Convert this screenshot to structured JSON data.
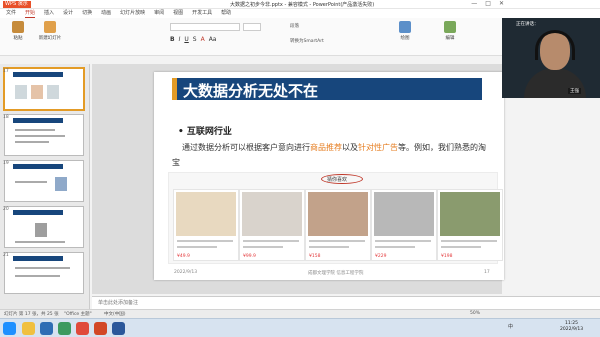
{
  "window": {
    "app_label": "WPS 演示",
    "title": "大数据之初步今非.pptx - 兼容模式 - PowerPoint(产品激活失败)",
    "controls": [
      "—",
      "□",
      "✕"
    ]
  },
  "ribbon": {
    "tabs": [
      "文件",
      "开始",
      "插入",
      "设计",
      "切换",
      "动画",
      "幻灯片放映",
      "审阅",
      "视图",
      "开发工具",
      "帮助"
    ],
    "active_tab": "开始",
    "groups": {
      "paste": "粘贴",
      "new_slide": "新建幻灯片",
      "font_name": "",
      "font_size": "",
      "format_row": [
        "B",
        "I",
        "U",
        "S",
        "A",
        "Aa"
      ],
      "paragraph": "段落",
      "drawing": "绘图",
      "edit": "编辑",
      "convert": "转换为SmartArt"
    }
  },
  "slide_panel": {
    "slides": [
      {
        "num": "17",
        "active": true
      },
      {
        "num": "18",
        "active": false
      },
      {
        "num": "19",
        "active": false
      },
      {
        "num": "20",
        "active": false
      },
      {
        "num": "21",
        "active": false
      },
      {
        "num": "22",
        "active": false
      }
    ]
  },
  "slide": {
    "title": "大数据分析无处不在",
    "bullet": "•   互联网行业",
    "para_pre": "通过数据分析可以根据客户意向进行",
    "hl1": "商品推荐",
    "para_mid": "以及",
    "hl2": "针对性广告",
    "para_post": "等。例如，我们熟悉的淘宝",
    "screenshot_label": "猜你喜欢",
    "products": [
      {
        "price": "¥49.9"
      },
      {
        "price": "¥99.9"
      },
      {
        "price": "¥158"
      },
      {
        "price": "¥229"
      },
      {
        "price": "¥198"
      }
    ],
    "footer_date": "2022/9/13",
    "footer_school": "成都文理学院 信息工程学院",
    "page": "17",
    "accent": "#e39b26",
    "title_bg": "#17467c"
  },
  "notes": {
    "placeholder": "单击此处添加备注"
  },
  "status": {
    "slide_info": "幻灯片 第 17 张，共 25 张",
    "theme": "\"Office 主题\"",
    "lang": "中文(中国)",
    "zoom": "50%"
  },
  "webcam": {
    "status": "正在讲话：",
    "name": "王强"
  },
  "taskbar": {
    "clock_time": "11:25",
    "clock_date": "2022/9/13",
    "tray_lang": "中"
  }
}
